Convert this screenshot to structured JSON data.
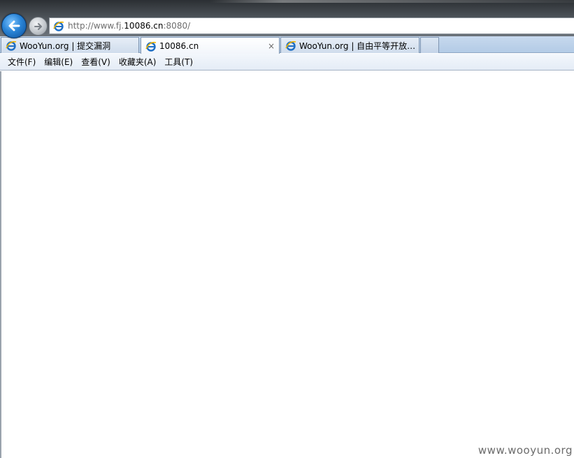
{
  "browser": {
    "address": {
      "url_prefix": "http://www.fj.",
      "url_domain": "10086.cn",
      "url_suffix": ":8080/"
    },
    "icons": {
      "back": "back-arrow-icon",
      "forward": "forward-arrow-icon",
      "page": "ie-page-icon",
      "close": "close-icon"
    },
    "tabs": [
      {
        "label": "WooYun.org | 提交漏洞",
        "active": false
      },
      {
        "label": "10086.cn",
        "active": true,
        "close": "×"
      },
      {
        "label": "WooYun.org | 自由平等开放…",
        "active": false
      }
    ],
    "menu": [
      {
        "label": "文件(F)"
      },
      {
        "label": "编辑(E)"
      },
      {
        "label": "查看(V)"
      },
      {
        "label": "收藏夹(A)"
      },
      {
        "label": "工具(T)"
      }
    ]
  },
  "watermark": "www.wooyun.org",
  "colors": {
    "accent_blue": "#2a84d6",
    "ie_icon_blue": "#1f6fc4",
    "ie_icon_gold": "#f0b400"
  }
}
